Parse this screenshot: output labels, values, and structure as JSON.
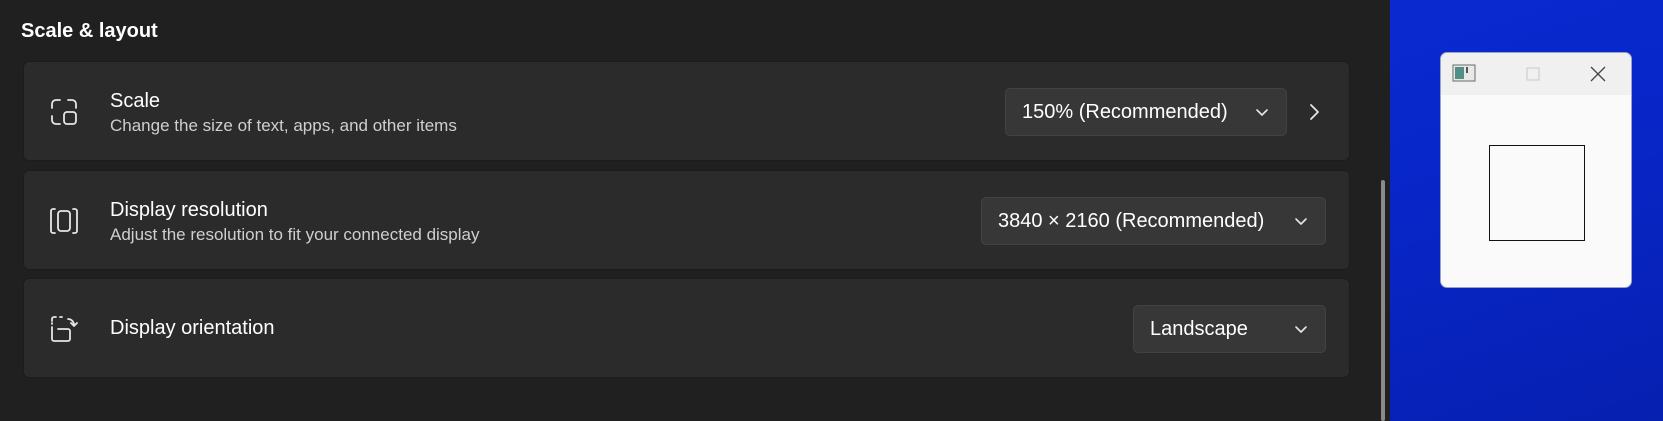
{
  "section": {
    "title": "Scale & layout"
  },
  "scale": {
    "title": "Scale",
    "description": "Change the size of text, apps, and other items",
    "value": "150% (Recommended)",
    "icon": "scale-icon"
  },
  "resolution": {
    "title": "Display resolution",
    "description": "Adjust the resolution to fit your connected display",
    "value": "3840 × 2160 (Recommended)",
    "icon": "resolution-icon"
  },
  "orientation": {
    "title": "Display orientation",
    "value": "Landscape",
    "icon": "orientation-icon"
  },
  "colors": {
    "pane_bg": "#202020",
    "card_bg": "#2b2b2b",
    "dropdown_bg": "#373737",
    "desktop_bg": "#0826c8"
  }
}
